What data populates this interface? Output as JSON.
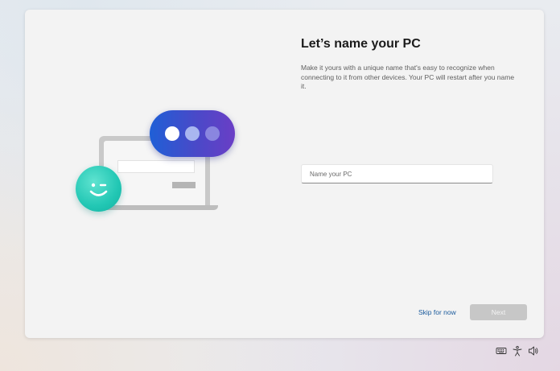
{
  "oobe": {
    "title": "Let’s name your PC",
    "description": "Make it yours with a unique name that's easy to recognize when connecting to it from other devices. Your PC will restart after you name it.",
    "name_input": {
      "placeholder": "Name your PC",
      "value": ""
    },
    "skip_label": "Skip for now",
    "next_label": "Next"
  },
  "colors": {
    "link": "#1a5a9c",
    "next_disabled_bg": "#c7c7c7",
    "bubble_gradient": [
      "#1f5fd6",
      "#6a3ec6"
    ],
    "smiley": "#22c7b4"
  },
  "tray": {
    "icons": [
      "keyboard-icon",
      "accessibility-icon",
      "volume-icon"
    ]
  }
}
